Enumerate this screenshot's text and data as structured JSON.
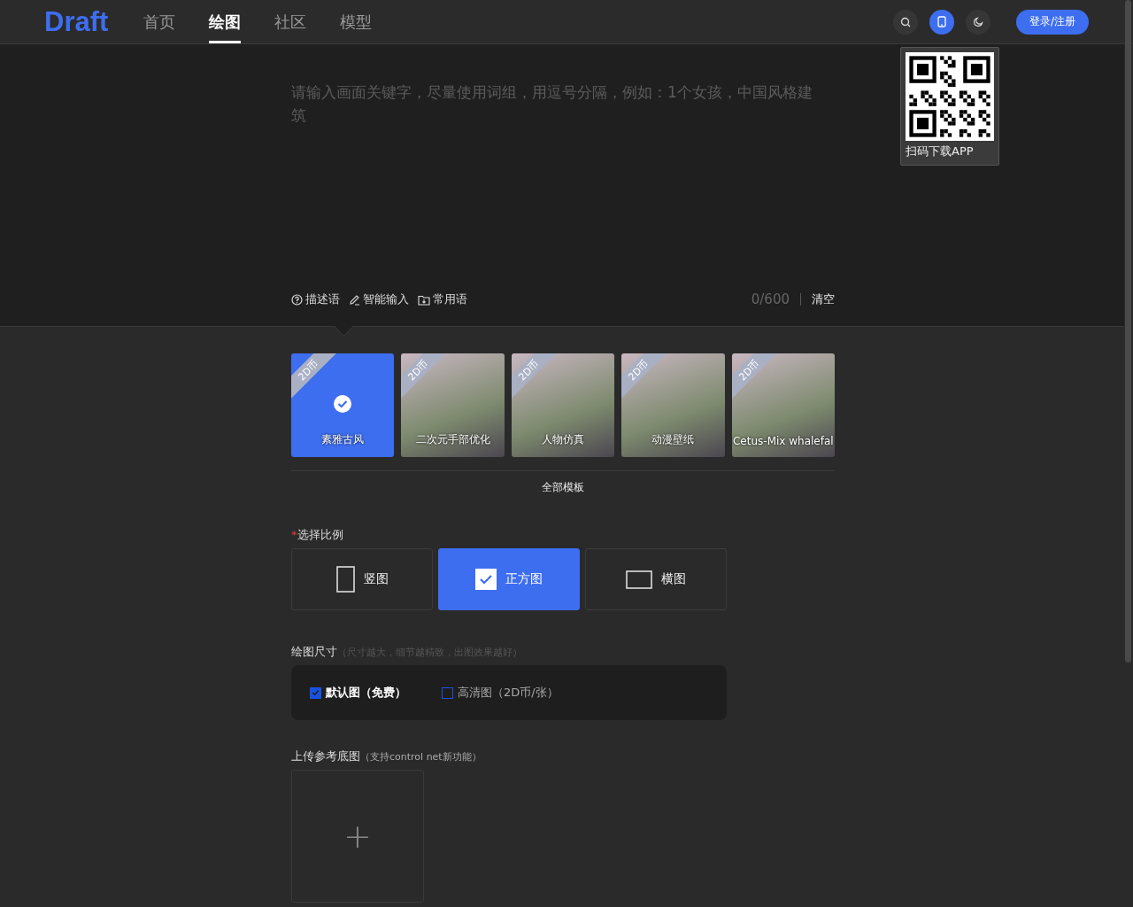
{
  "header": {
    "logo": "Draft",
    "nav": [
      {
        "label": "首页",
        "selected": false
      },
      {
        "label": "绘图",
        "selected": true
      },
      {
        "label": "社区",
        "selected": false
      },
      {
        "label": "模型",
        "selected": false
      }
    ],
    "login_button": "登录/注册",
    "phone_selected": true
  },
  "qr_popup": {
    "caption": "扫码下载APP"
  },
  "prompt": {
    "placeholder": "请输入画面关键字，尽量使用词组，用逗号分隔，例如：1个女孩，中国风格建筑",
    "tools": [
      {
        "kind": "help",
        "label": "描述语"
      },
      {
        "kind": "pen",
        "label": "智能输入"
      },
      {
        "kind": "folder",
        "label": "常用语"
      }
    ],
    "counter": "0/600",
    "clear": "清空"
  },
  "templates": [
    {
      "label": "素雅古风",
      "badge": "2D币",
      "selected": true
    },
    {
      "label": "二次元手部优化",
      "badge": "2D币",
      "selected": false
    },
    {
      "label": "人物仿真",
      "badge": "2D币",
      "selected": false
    },
    {
      "label": "动漫壁纸",
      "badge": "2D币",
      "selected": false
    },
    {
      "label": "Cetus-Mix whalefal",
      "badge": "2D币",
      "selected": false
    }
  ],
  "all_templates": "全部模板",
  "ratio": {
    "required_mark": "*",
    "title": "选择比例",
    "options": [
      {
        "kind": "portrait",
        "label": "竖图",
        "selected": false
      },
      {
        "kind": "square",
        "label": "正方图",
        "selected": true
      },
      {
        "kind": "landscape",
        "label": "横图",
        "selected": false
      }
    ]
  },
  "size": {
    "title": "绘图尺寸",
    "hint": "（尺寸越大，细节越精致，出图效果越好）",
    "options": [
      {
        "label": "默认图（免费）",
        "checked": true
      },
      {
        "label": "高清图（2D币/张）",
        "checked": false
      }
    ]
  },
  "upload": {
    "title": "上传参考底图",
    "hint": "（支持control net新功能）",
    "add": "+"
  }
}
